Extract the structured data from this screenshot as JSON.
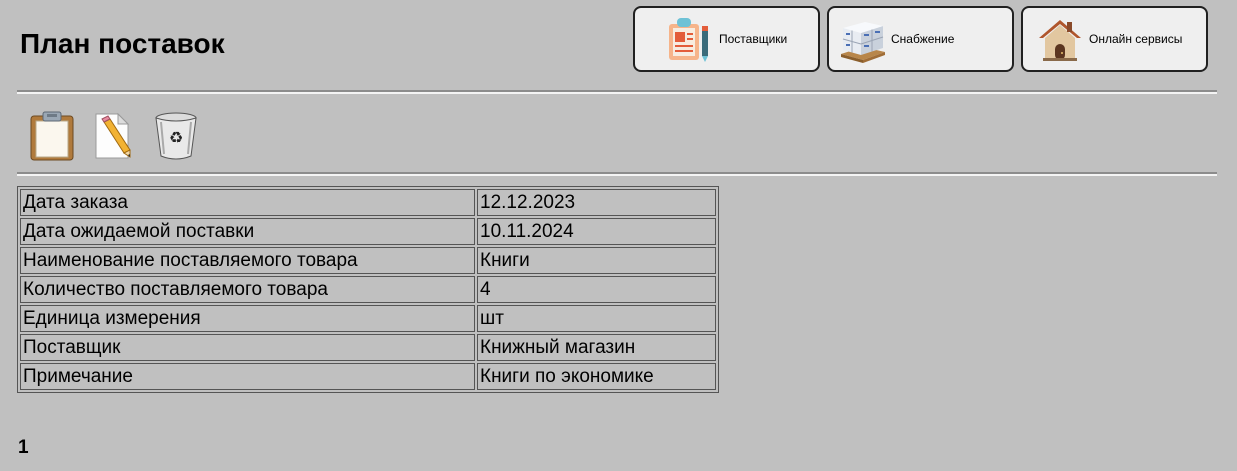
{
  "page": {
    "title": "План поставок",
    "page_number": "1"
  },
  "nav": {
    "suppliers_label": "Поставщики",
    "supply_label": "Снабжение",
    "online_label": "Онлайн сервисы",
    "suppliers_icon": "clipboard-form-icon",
    "supply_icon": "boxes-pallet-icon",
    "online_icon": "house-icon"
  },
  "toolbar": {
    "add_icon": "clipboard-icon",
    "edit_icon": "pencil-document-icon",
    "delete_icon": "recycle-bin-icon"
  },
  "record": {
    "rows": [
      {
        "label": "Дата заказа",
        "value": "12.12.2023"
      },
      {
        "label": "Дата ожидаемой поставки",
        "value": "10.11.2024"
      },
      {
        "label": "Наименование поставляемого товара",
        "value": "Книги"
      },
      {
        "label": "Количество поставляемого товара",
        "value": "4"
      },
      {
        "label": "Единица измерения",
        "value": "шт"
      },
      {
        "label": "Поставщик",
        "value": "Книжный магазин"
      },
      {
        "label": "Примечание",
        "value": "Книги по экономике"
      }
    ]
  },
  "colors": {
    "background": "#c0c0c0",
    "button_bg": "#efefef",
    "button_border": "#202020"
  }
}
